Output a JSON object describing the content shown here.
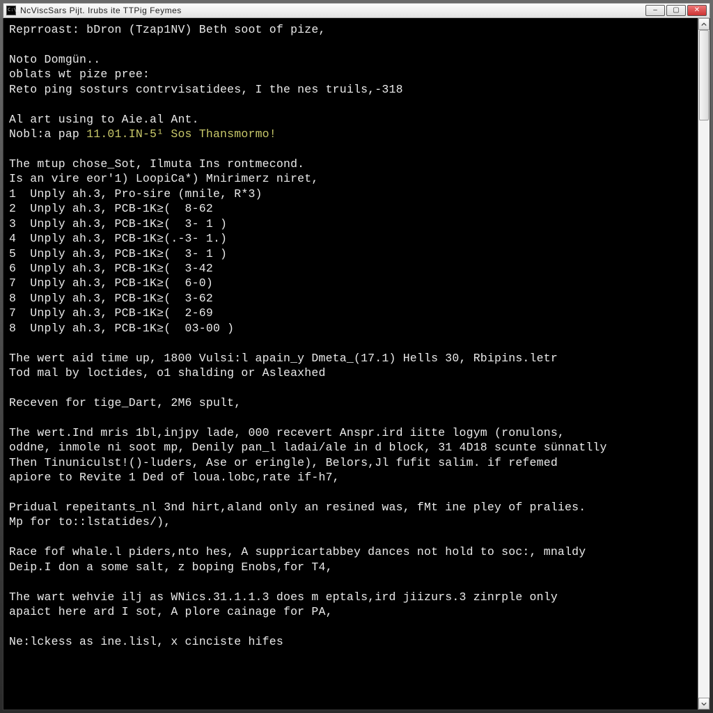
{
  "window": {
    "title": "NcViscSars Pijt. Irubs ite TTPig Feymes"
  },
  "console": {
    "lines": [
      {
        "t": "Reprroast: bDron (Tzap1NV) Beth soot of pize,",
        "hl": false
      },
      {
        "t": "",
        "hl": false
      },
      {
        "t": "Noto Domgün..",
        "hl": false
      },
      {
        "t": "oblats wt pize pree:",
        "hl": false
      },
      {
        "t": "Reto ping sosturs contrvisatidees, I the nes truils,-318",
        "hl": false
      },
      {
        "t": "",
        "hl": false
      },
      {
        "t": "Al art using to Aie.al Ant.",
        "hl": false
      },
      {
        "t_pre": "Nobl:a pap ",
        "t_hl": "11.01.IN-5¹ Sos Thansmormo!",
        "hl": true
      },
      {
        "t": "",
        "hl": false
      },
      {
        "t": "The mtup chose_Sot, Ilmuta Ins rontmecond.",
        "hl": false
      },
      {
        "t": "Is an vire eor'1) LoopiCa*) Mnirimerz niret,",
        "hl": false
      },
      {
        "t": "1  Unply ah.3, Pro-sire (mnile, R*3)",
        "hl": false
      },
      {
        "t": "2  Unply ah.3, PCB-1K≥(  8-62",
        "hl": false
      },
      {
        "t": "3  Unply ah.3, PCB-1K≥(  3- 1 )",
        "hl": false
      },
      {
        "t": "4  Unply ah.3, PCB-1K≥(.-3- 1.)",
        "hl": false
      },
      {
        "t": "5  Unply ah.3, PCB-1K≥(  3- 1 )",
        "hl": false
      },
      {
        "t": "6  Unply ah.3, PCB-1K≥(  3-42",
        "hl": false
      },
      {
        "t": "7  Unply ah.3, PCB-1K≥(  6-0)",
        "hl": false
      },
      {
        "t": "8  Unply ah.3, PCB-1K≥(  3-62",
        "hl": false
      },
      {
        "t": "7  Unply ah.3, PCB-1K≥(  2-69",
        "hl": false
      },
      {
        "t": "8  Unply ah.3, PCB-1K≥(  03-00 )",
        "hl": false
      },
      {
        "t": "",
        "hl": false
      },
      {
        "t": "The wert aid time up, 1800 Vulsi:l apain_y Dmeta_(17.1) Hells 30, Rbipins.letr",
        "hl": false
      },
      {
        "t": "Tod mal by loctides, o1 shalding or Asleaxhed",
        "hl": false
      },
      {
        "t": "",
        "hl": false
      },
      {
        "t": "Receven for tige_Dart, 2M6 spult,",
        "hl": false
      },
      {
        "t": "",
        "hl": false
      },
      {
        "t": "The wert.Ind mris 1bl,injpy lade, 000 recevert Anspr.ird iitte logym (ronulons,",
        "hl": false
      },
      {
        "t": "oddne, inmole ni soot mp, Denily pan_l ladai/ale in d block, 31 4D18 scunte sünnatlly",
        "hl": false
      },
      {
        "t": "Then Tinuniculst!()-luders, Ase or eringle), Belors,Jl fufit salim. if refemed",
        "hl": false
      },
      {
        "t": "apiore to Revite 1 Ded of loua.lobc,rate if-h7,",
        "hl": false
      },
      {
        "t": "",
        "hl": false
      },
      {
        "t": "Pridual repeitants_nl 3nd hirt,aland only an resined was, fMt ine pley of pralies.",
        "hl": false
      },
      {
        "t": "Mp for to::lstatides/),",
        "hl": false
      },
      {
        "t": "",
        "hl": false
      },
      {
        "t": "Race fof whale.l piders,nto hes, A suppricartabbey dances not hold to soc:, mnaldy",
        "hl": false
      },
      {
        "t": "Deip.I don a some salt, z boping Enobs,for T4,",
        "hl": false
      },
      {
        "t": "",
        "hl": false
      },
      {
        "t": "The wart wehvie ilj as WNics.31.1.1.3 does m eptals,ird jiizurs.3 zinrple only",
        "hl": false
      },
      {
        "t": "apaict here ard I sot, A plore cainage for PA,",
        "hl": false
      },
      {
        "t": "",
        "hl": false
      },
      {
        "t": "Ne:lckess as ine.lisl, x cinciste hifes",
        "hl": false
      }
    ]
  }
}
